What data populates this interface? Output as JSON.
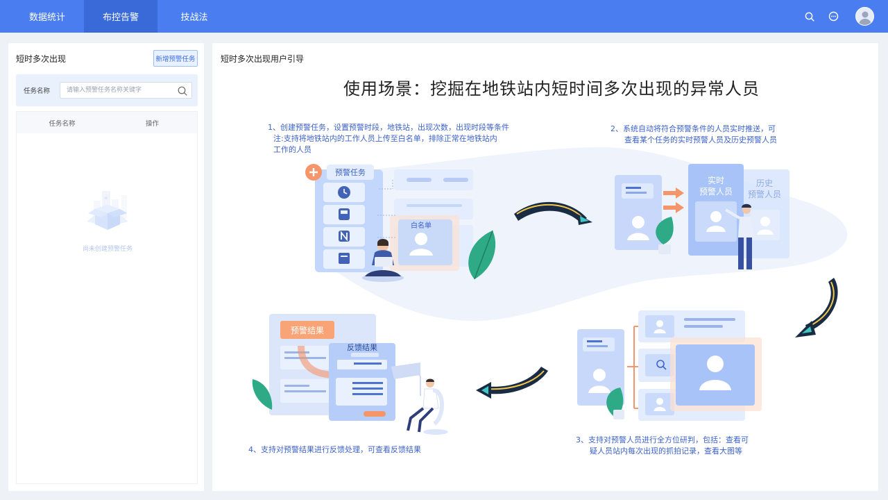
{
  "nav": {
    "tabs": [
      {
        "label": "数据统计"
      },
      {
        "label": "布控告警"
      },
      {
        "label": "技战法"
      }
    ],
    "active_index": 1
  },
  "left_panel": {
    "title": "短时多次出现",
    "add_button": "新增预警任务",
    "search": {
      "label": "任务名称",
      "placeholder": "请输入预警任务名称关键字"
    },
    "table": {
      "columns": [
        "任务名称",
        "操作"
      ],
      "rows": []
    },
    "empty_text": "尚未创建预警任务"
  },
  "right_panel": {
    "title": "短时多次出现用户引导",
    "headline": "使用场景：挖掘在地铁站内短时间多次出现的异常人员",
    "steps": [
      {
        "lines": [
          "1、创建预警任务，设置预警时段，地铁站，出现次数，出现时段等条件",
          "注:支持将地铁站内的工作人员上传至白名单，排除正常在地铁站内",
          "工作的人员"
        ]
      },
      {
        "lines": [
          "2、系统自动将符合预警条件的人员实时推送，可",
          "查看某个任务的实时预警人员及历史预警人员"
        ]
      },
      {
        "lines": [
          "3、支持对预警人员进行全方位研判，包括：查看可",
          "疑人员站内每次出现的抓拍记录，查看大图等"
        ]
      },
      {
        "lines": [
          "4、支持对预警结果进行反馈处理，可查看反馈结果"
        ]
      }
    ],
    "illustration_labels": {
      "task_card": "预警任务",
      "whitelist": "白名单",
      "realtime": [
        "实时",
        "预警人员"
      ],
      "history": [
        "历史",
        "预警人员"
      ],
      "result": "预警结果",
      "feedback": "反馈结果"
    }
  },
  "colors": {
    "primary": "#4a7ef0",
    "active_tab": "#3a6ad8",
    "step_text": "#3d63c9",
    "orange": "#f07a3a"
  }
}
